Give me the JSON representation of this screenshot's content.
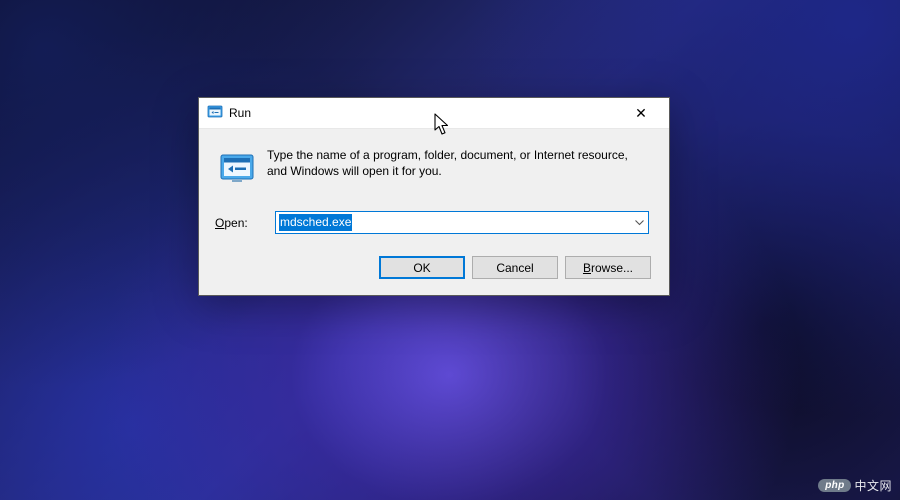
{
  "titlebar": {
    "title": "Run",
    "close_glyph": "✕"
  },
  "body": {
    "description": "Type the name of a program, folder, document, or Internet resource, and Windows will open it for you.",
    "open_label_prefix": "O",
    "open_label_rest": "pen:",
    "command_value": "mdsched.exe"
  },
  "buttons": {
    "ok": "OK",
    "cancel": "Cancel",
    "browse_prefix": "B",
    "browse_rest": "rowse..."
  },
  "watermark": {
    "badge": "php",
    "text": "中文网"
  }
}
